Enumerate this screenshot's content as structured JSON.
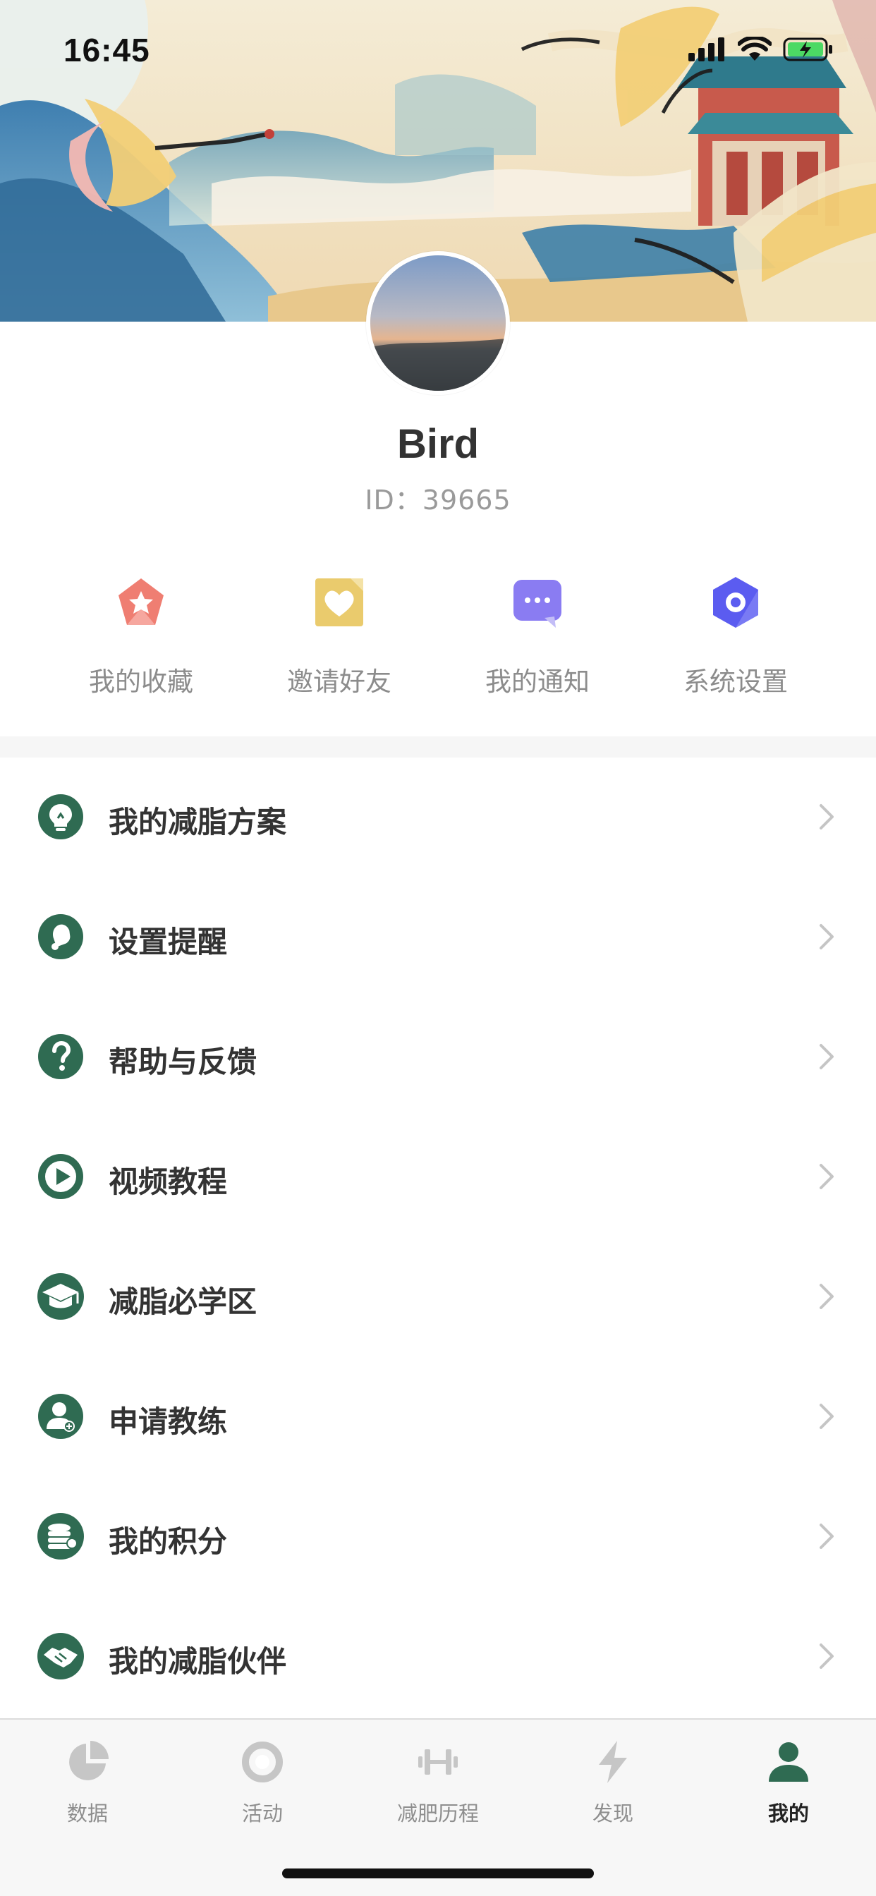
{
  "status_bar": {
    "time": "16:45",
    "battery_state": "charging"
  },
  "profile": {
    "name": "Bird",
    "id_label": "ID：39665"
  },
  "quick_actions": [
    {
      "label": "我的收藏",
      "icon": "star-icon",
      "color": "#ef7e72"
    },
    {
      "label": "邀请好友",
      "icon": "heart-card-icon",
      "color": "#eacb6d"
    },
    {
      "label": "我的通知",
      "icon": "chat-bubble-icon",
      "color": "#8a7cf2"
    },
    {
      "label": "系统设置",
      "icon": "hexagon-settings-icon",
      "color": "#5b5cf0"
    }
  ],
  "menu": [
    {
      "label": "我的减脂方案",
      "icon": "lightbulb-icon"
    },
    {
      "label": "设置提醒",
      "icon": "bell-icon"
    },
    {
      "label": "帮助与反馈",
      "icon": "question-icon"
    },
    {
      "label": "视频教程",
      "icon": "play-icon"
    },
    {
      "label": "减脂必学区",
      "icon": "graduation-cap-icon"
    },
    {
      "label": "申请教练",
      "icon": "coach-icon"
    },
    {
      "label": "我的积分",
      "icon": "coins-icon"
    },
    {
      "label": "我的减脂伙伴",
      "icon": "handshake-icon"
    }
  ],
  "tabs": [
    {
      "label": "数据",
      "icon": "pie-chart-icon",
      "active": false
    },
    {
      "label": "活动",
      "icon": "ring-icon",
      "active": false
    },
    {
      "label": "减肥历程",
      "icon": "dumbbell-icon",
      "active": false
    },
    {
      "label": "发现",
      "icon": "lightning-icon",
      "active": false
    },
    {
      "label": "我的",
      "icon": "person-icon",
      "active": true
    }
  ],
  "colors": {
    "accent_green": "#2f6b52",
    "menu_text": "#333333",
    "muted_text": "#8c8c8c",
    "tab_inactive": "#c6c6c6"
  }
}
